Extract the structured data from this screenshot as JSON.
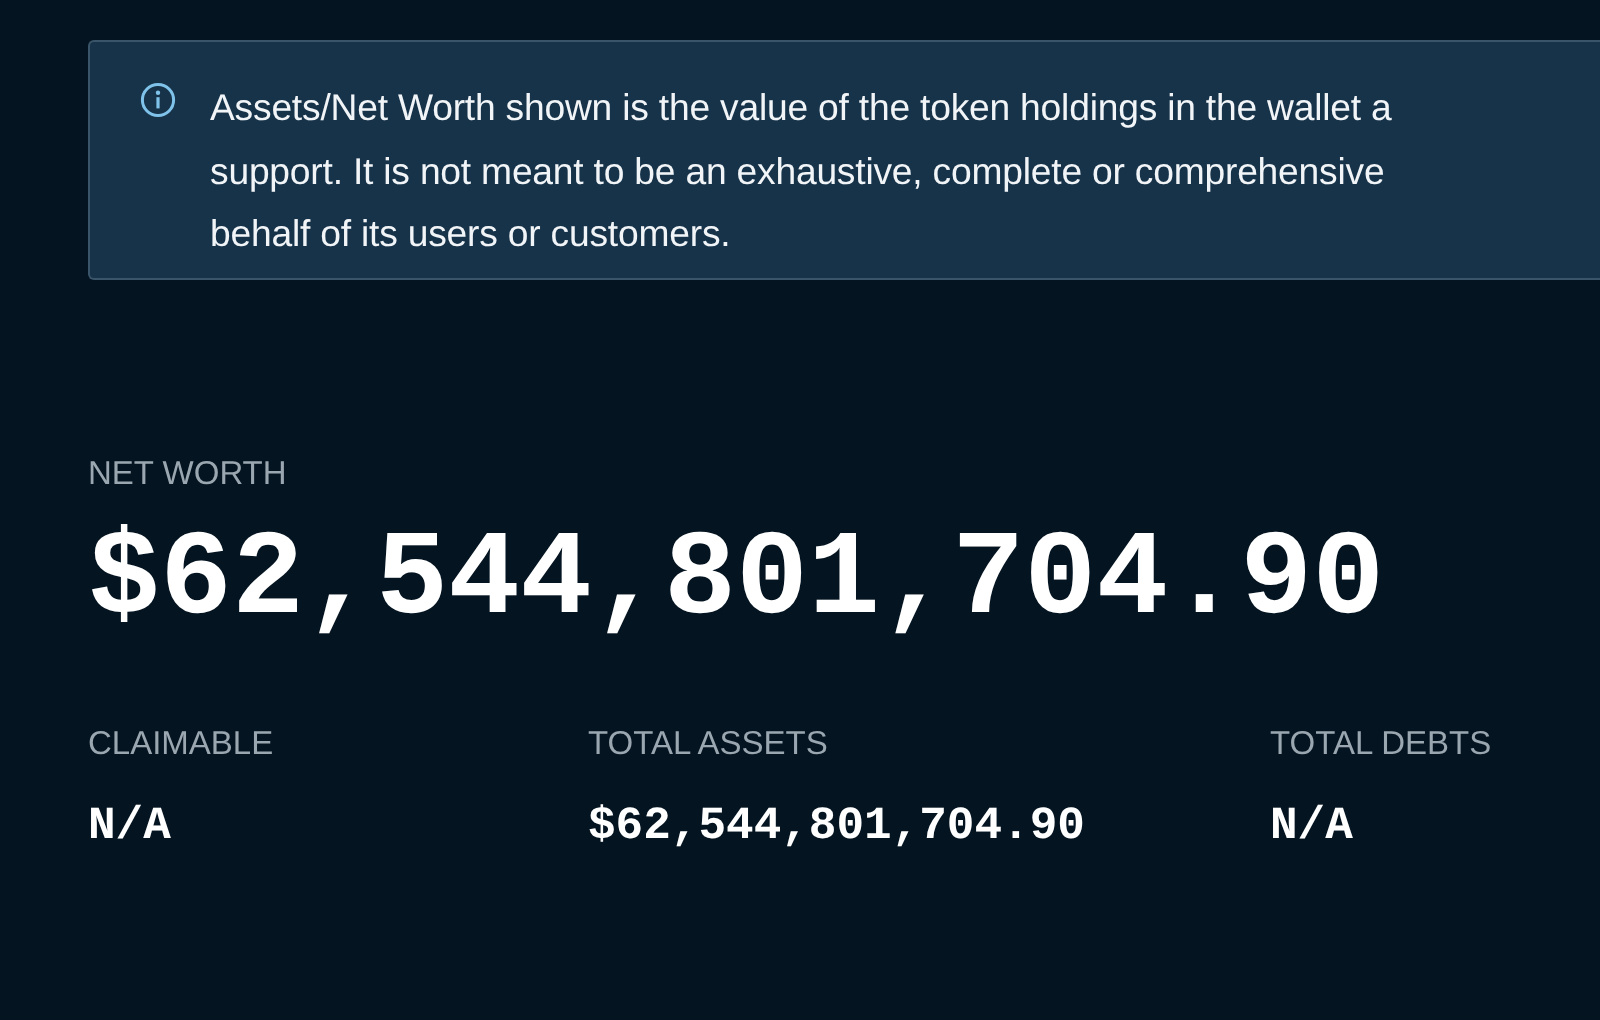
{
  "notice": {
    "lines": [
      "Assets/Net Worth shown is the value of the token holdings in the wallet a",
      "support. It is not meant to be an exhaustive, complete or comprehensive",
      "behalf of its users or customers."
    ]
  },
  "net_worth": {
    "label": "NET WORTH",
    "value": "$62,544,801,704.90"
  },
  "stats": [
    {
      "label": "CLAIMABLE",
      "value": "N/A"
    },
    {
      "label": "TOTAL ASSETS",
      "value": "$62,544,801,704.90"
    },
    {
      "label": "TOTAL DEBTS",
      "value": "N/A"
    }
  ]
}
